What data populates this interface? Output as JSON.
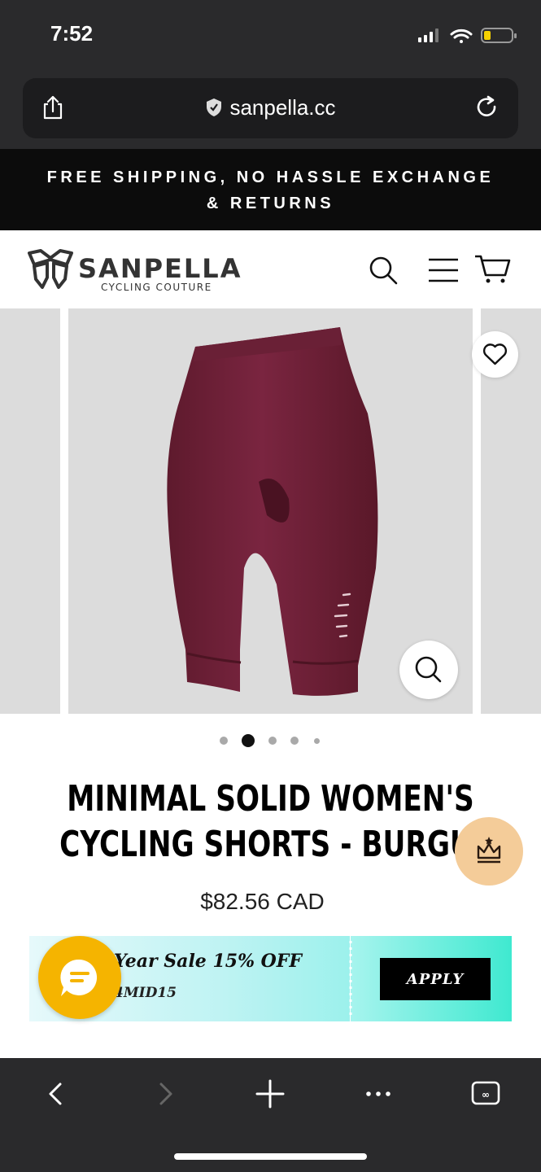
{
  "status_bar": {
    "time": "7:52"
  },
  "browser": {
    "url": "sanpella.cc"
  },
  "promo": {
    "line1": "FREE SHIPPING, NO HASSLE EXCHANGE",
    "line2": "& RETURNS"
  },
  "header": {
    "brand": "SANPELLA",
    "tagline": "CYCLING COUTURE"
  },
  "gallery": {
    "active_index": 2,
    "total": 5
  },
  "product": {
    "title_line1": "MINIMAL SOLID WOMEN'S",
    "title_line2": "CYCLING SHORTS - BURGUND",
    "price": "$82.56 CAD"
  },
  "coupon": {
    "headline": "Year Sale 15% OFF",
    "code": "4MID15",
    "apply_label": "APPLY"
  },
  "colors": {
    "chrome": "#2a2a2c",
    "promo_bg": "#0c0c0c",
    "shorts": "#6e1f35",
    "chat": "#f5b400",
    "crown_bg": "#f4cc99",
    "coupon_accent": "#3fe9d0"
  },
  "icons": [
    "share-icon",
    "shield-icon",
    "reload-icon",
    "search-icon",
    "menu-icon",
    "cart-icon",
    "heart-icon",
    "zoom-icon",
    "crown-icon",
    "chat-icon",
    "back-icon",
    "forward-icon",
    "new-tab-icon",
    "more-icon",
    "tabs-icon"
  ]
}
